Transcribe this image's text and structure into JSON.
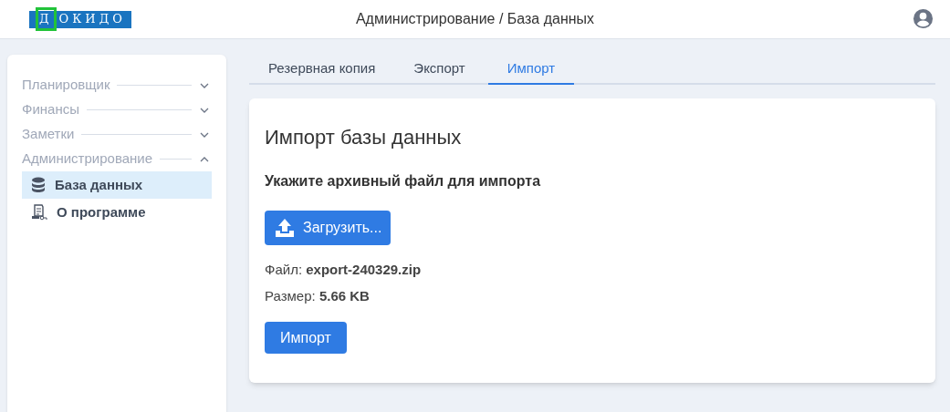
{
  "header": {
    "logo": {
      "first_letter": "Д",
      "rest": "ОКИДО"
    },
    "title": "Администрирование / База данных"
  },
  "sidebar": {
    "sections": [
      {
        "label": "Планировщик",
        "expanded": false
      },
      {
        "label": "Финансы",
        "expanded": false
      },
      {
        "label": "Заметки",
        "expanded": false
      },
      {
        "label": "Администрирование",
        "expanded": true,
        "items": [
          {
            "label": "База данных",
            "kind": "database",
            "selected": true
          },
          {
            "label": "О программе",
            "kind": "about",
            "selected": false
          }
        ]
      }
    ]
  },
  "tabs": [
    {
      "label": "Резервная копия",
      "selected": false
    },
    {
      "label": "Экспорт",
      "selected": false
    },
    {
      "label": "Импорт",
      "selected": true
    }
  ],
  "card": {
    "title": "Импорт базы данных",
    "subtitle": "Укажите архивный файл для импорта",
    "upload_button": "Загрузить...",
    "file_line": "Файл: **export-240329.zip**",
    "size_line": "Размер: **5.66 KB**",
    "import_button": "Импорт"
  }
}
